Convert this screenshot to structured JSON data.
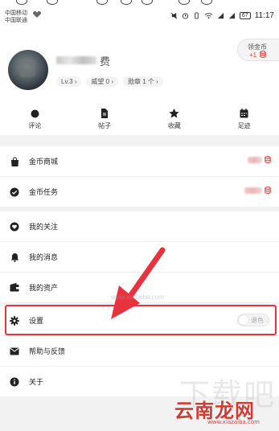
{
  "status_bar": {
    "carrier_1": "中国移动",
    "carrier_2": "中国联通",
    "battery": "67",
    "time": "11:17"
  },
  "profile": {
    "username_tail": "费",
    "chips": [
      "Lv.3 ›",
      "威望 0 ›",
      "勋章 1 个 ›"
    ],
    "coins": {
      "label": "领金币",
      "reward": "+1"
    }
  },
  "quick_actions": [
    {
      "label": "评论",
      "icon": "comment-icon"
    },
    {
      "label": "帖子",
      "icon": "post-icon"
    },
    {
      "label": "收藏",
      "icon": "star-icon"
    },
    {
      "label": "足迹",
      "icon": "calendar-icon"
    }
  ],
  "menu_group_1": [
    {
      "label": "金币商城",
      "icon": "bag-icon"
    },
    {
      "label": "金币任务",
      "icon": "check-circle-icon"
    }
  ],
  "menu_group_2": [
    {
      "label": "我的关注",
      "icon": "heart-icon"
    },
    {
      "label": "我的消息",
      "icon": "bell-icon"
    },
    {
      "label": "我的资产",
      "icon": "wallet-icon"
    }
  ],
  "menu_group_3": [
    {
      "label": "设置",
      "icon": "gear-icon",
      "toggle_label": "退色"
    },
    {
      "label": "帮助与反馈",
      "icon": "mail-icon"
    },
    {
      "label": "关于",
      "icon": "info-icon"
    }
  ],
  "watermark": {
    "main": "云南龙网",
    "faint": "下载吧",
    "url": "www.xiazaiba.com"
  },
  "colors": {
    "highlight": "#e8333f",
    "coin": "#e53935",
    "watermark": "#d23b33"
  }
}
